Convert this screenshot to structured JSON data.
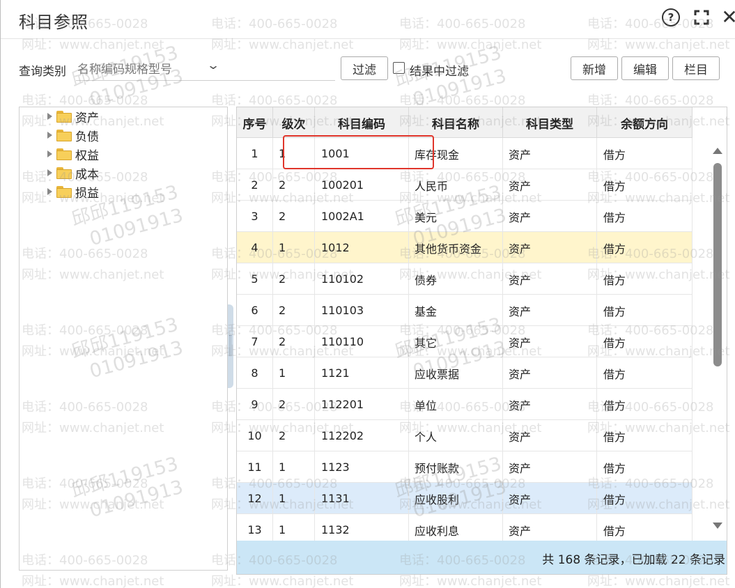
{
  "dialog": {
    "title": "科目参照",
    "help_icon": "?"
  },
  "toolbar": {
    "query_label": "查询类别",
    "query_placeholder": "名称编码规格型号",
    "filter_button": "过滤",
    "in_result_filter_label": "结果中过滤",
    "add_button": "新增",
    "edit_button": "编辑",
    "columns_button": "栏目"
  },
  "tree": {
    "items": [
      "资产",
      "负债",
      "权益",
      "成本",
      "损益"
    ]
  },
  "grid": {
    "columns": [
      "序号",
      "级次",
      "科目编码",
      "科目名称",
      "科目类型",
      "余额方向"
    ],
    "rows": [
      [
        "1",
        "1",
        "1001",
        "库存现金",
        "资产",
        "借方"
      ],
      [
        "2",
        "2",
        "100201",
        "人民币",
        "资产",
        "借方"
      ],
      [
        "3",
        "2",
        "1002A1",
        "美元",
        "资产",
        "借方"
      ],
      [
        "4",
        "1",
        "1012",
        "其他货币资金",
        "资产",
        "借方"
      ],
      [
        "5",
        "2",
        "110102",
        "债券",
        "资产",
        "借方"
      ],
      [
        "6",
        "2",
        "110103",
        "基金",
        "资产",
        "借方"
      ],
      [
        "7",
        "2",
        "110110",
        "其它",
        "资产",
        "借方"
      ],
      [
        "8",
        "1",
        "1121",
        "应收票据",
        "资产",
        "借方"
      ],
      [
        "9",
        "2",
        "112201",
        "单位",
        "资产",
        "借方"
      ],
      [
        "10",
        "2",
        "112202",
        "个人",
        "资产",
        "借方"
      ],
      [
        "11",
        "1",
        "1123",
        "预付账款",
        "资产",
        "借方"
      ],
      [
        "12",
        "1",
        "1131",
        "应收股利",
        "资产",
        "借方"
      ],
      [
        "13",
        "1",
        "1132",
        "应收利息",
        "资产",
        "借方"
      ]
    ],
    "footer": "共 168 条记录，已加载 22 条记录"
  },
  "watermark": {
    "phone": "电话：400-665-0028",
    "site": "网址：www.chanjet.net",
    "user_line1": "邱邱119153",
    "user_line2": "01091913"
  },
  "colors": {
    "highlight_row_yellow": "#fff5cc",
    "highlight_row_blue": "#dcebfa",
    "footer_bg": "#cbe6f6",
    "annotation_red": "#e0352b"
  }
}
